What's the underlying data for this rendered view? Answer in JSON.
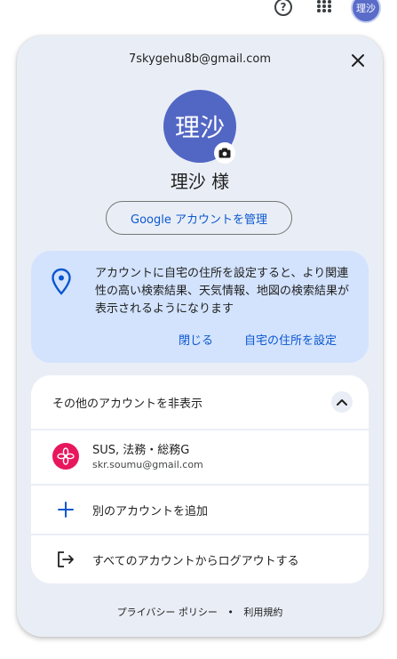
{
  "topbar": {
    "avatar_text": "理沙",
    "help_glyph": "?"
  },
  "card": {
    "email": "7skygehu8b@gmail.com",
    "avatar_text": "理沙",
    "name": "理沙 様",
    "manage_account_label": "Google アカウントを管理"
  },
  "promo": {
    "text": "アカウントに自宅の住所を設定すると、より関連性の高い検索結果、天気情報、地図の検索結果が表示されるようになります",
    "close_label": "閉じる",
    "set_address_label": "自宅の住所を設定"
  },
  "accounts": {
    "toggle_label": "その他のアカウントを非表示",
    "items": [
      {
        "name": "SUS, 法務・総務G",
        "email": "skr.soumu@gmail.com"
      }
    ],
    "add_account_label": "別のアカウントを追加",
    "logout_label": "すべてのアカウントからログアウトする"
  },
  "footer": {
    "privacy_label": "プライバシー ポリシー",
    "separator": "•",
    "terms_label": "利用規約"
  },
  "colors": {
    "card_bg": "#e9eef6",
    "promo_bg": "#d3e3fd",
    "accent": "#0b57d0",
    "avatar_bg": "#5266c4",
    "account_avatar_bg": "#e8175d"
  },
  "icons": [
    "help-icon",
    "apps-icon",
    "close-icon",
    "camera-icon",
    "location-pin-icon",
    "chevron-up-icon",
    "flower-icon",
    "plus-icon",
    "logout-icon"
  ]
}
